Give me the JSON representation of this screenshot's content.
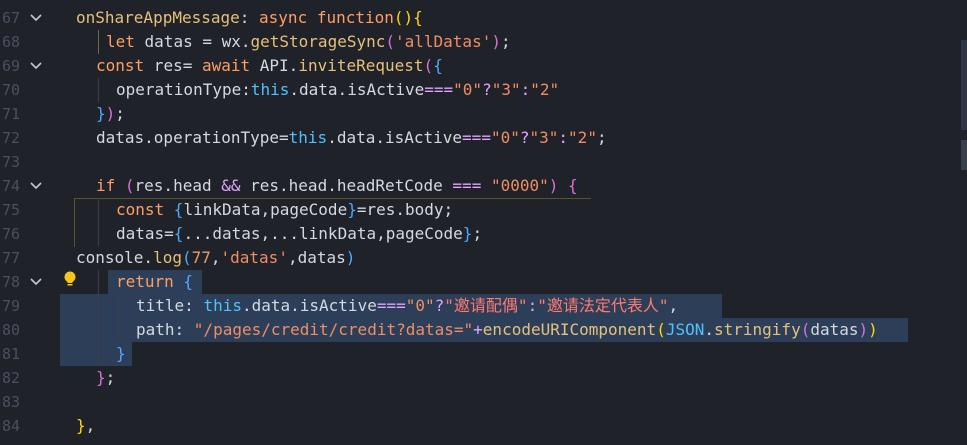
{
  "editor": {
    "lines": [
      {
        "num": "67",
        "fold": true
      },
      {
        "num": "68",
        "fold": false
      },
      {
        "num": "69",
        "fold": true
      },
      {
        "num": "70",
        "fold": false
      },
      {
        "num": "71",
        "fold": false
      },
      {
        "num": "72",
        "fold": false
      },
      {
        "num": "73",
        "fold": false
      },
      {
        "num": "74",
        "fold": true
      },
      {
        "num": "75",
        "fold": false
      },
      {
        "num": "76",
        "fold": false
      },
      {
        "num": "77",
        "fold": false
      },
      {
        "num": "78",
        "fold": true
      },
      {
        "num": "79",
        "fold": false
      },
      {
        "num": "80",
        "fold": false
      },
      {
        "num": "81",
        "fold": false
      },
      {
        "num": "82",
        "fold": false
      },
      {
        "num": "83",
        "fold": false
      },
      {
        "num": "84",
        "fold": false
      }
    ],
    "tokens": {
      "l67_fn": "onShareAppMessage",
      "l67_colon": ": ",
      "l67_async": "async",
      "l67_function": " function",
      "l67_paren": "()",
      "l67_brace": "{",
      "l68_let": "let",
      "l68_a": " datas = wx.",
      "l68_fn": "getStorageSync",
      "l68_po": "(",
      "l68_str": "'allDatas'",
      "l68_pc": ")",
      "l68_semi": ";",
      "l69_const": "const",
      "l69_a": " res= ",
      "l69_await": "await",
      "l69_b": " API.",
      "l69_fn": "inviteRequest",
      "l69_po": "(",
      "l69_bo": "{",
      "l70_a": "operationType:",
      "l70_this": "this",
      "l70_b": ".data.isActive",
      "l70_op": "===",
      "l70_s1": "\"0\"",
      "l70_q": "?",
      "l70_s2": "\"3\"",
      "l70_c": ":",
      "l70_s3": "\"2\"",
      "l71_bc": "}",
      "l71_pc": ")",
      "l71_semi": ";",
      "l72_a": "datas.operationType=",
      "l72_this": "this",
      "l72_b": ".data.isActive",
      "l72_op": "===",
      "l72_s1": "\"0\"",
      "l72_q": "?",
      "l72_s2": "\"3\"",
      "l72_c": ":",
      "l72_s3": "\"2\"",
      "l72_semi": ";",
      "l74_if": "if",
      "l74_po": " (",
      "l74_a": "res.head ",
      "l74_and": "&&",
      "l74_b": " res.head.headRetCode ",
      "l74_op": "===",
      "l74_s": " \"0000\"",
      "l74_pc": ")",
      "l74_bo": " {",
      "l75_const": "const",
      "l75_bo": " {",
      "l75_a": "linkData,pageCode",
      "l75_bc": "}",
      "l75_b": "=res.body;",
      "l76_a": "datas=",
      "l76_bo": "{",
      "l76_b": "...datas,...linkData,pageCode",
      "l76_bc": "}",
      "l76_semi": ";",
      "l77_a": "console.",
      "l77_fn": "log",
      "l77_po": "(",
      "l77_num": "77",
      "l77_comma": ",",
      "l77_str": "'datas'",
      "l77_b": ",datas",
      "l77_pc": ")",
      "l78_return": "return",
      "l78_bo": " {",
      "l79_a": "title: ",
      "l79_this": "this",
      "l79_b": ".data.isActive",
      "l79_op": "===",
      "l79_s1": "\"0\"",
      "l79_q": "?",
      "l79_s2": "\"邀请配偶\"",
      "l79_c": ":",
      "l79_s3": "\"邀请法定代表人\"",
      "l79_comma": ",",
      "l80_a": "path: ",
      "l80_s": "\"/pages/credit/credit?datas=\"",
      "l80_plus": "+",
      "l80_fn": "encodeURIComponent",
      "l80_po": "(",
      "l80_json": "JSON",
      "l80_dot": ".",
      "l80_fn2": "stringify",
      "l80_po2": "(",
      "l80_b": "datas",
      "l80_pc2": ")",
      "l80_pc": ")",
      "l81_bc": "}",
      "l82_bc": "}",
      "l82_semi": ";",
      "l84_bc": "}",
      "l84_comma": ","
    },
    "colors": {
      "background": "#1f2229",
      "selection": "#2d3f58",
      "keyword": "#ff9e64",
      "function": "#e5c07b",
      "string": "#f08d64",
      "this": "#4fc1ff"
    }
  }
}
